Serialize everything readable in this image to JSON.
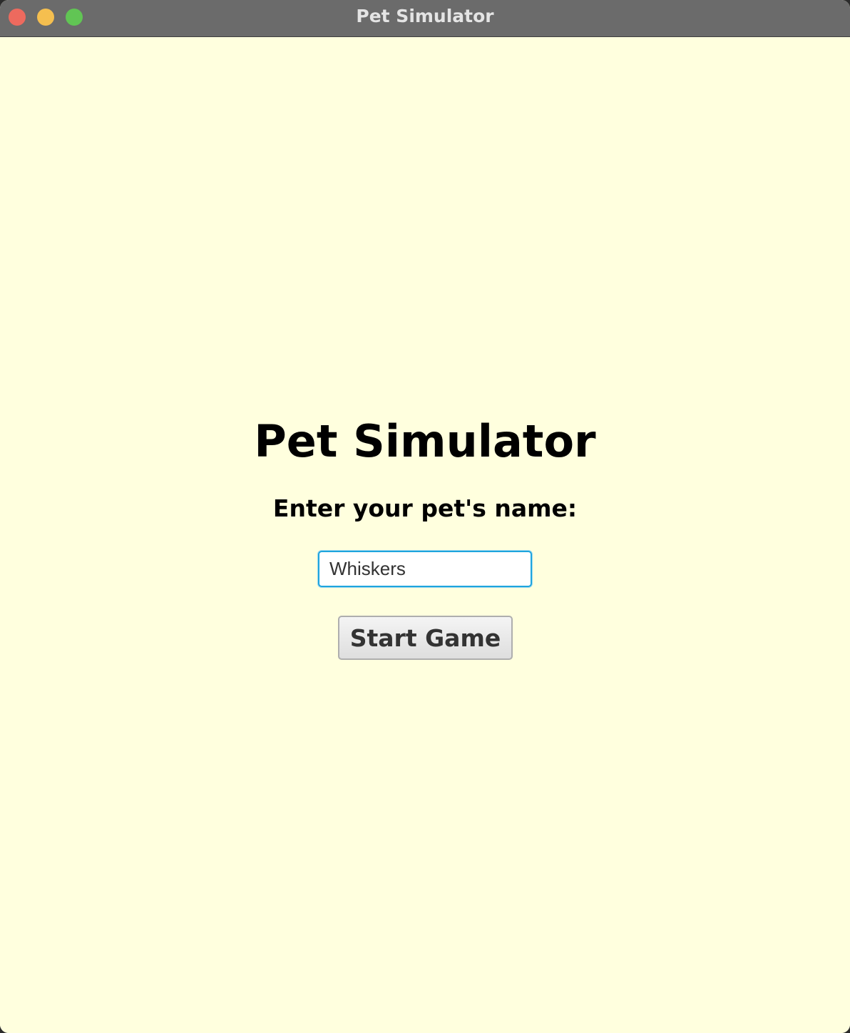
{
  "window": {
    "title": "Pet Simulator"
  },
  "main": {
    "title": "Pet Simulator",
    "prompt": "Enter your pet's name:",
    "name_input": {
      "value": "Whiskers",
      "focused": true
    },
    "start_button_label": "Start Game"
  },
  "colors": {
    "background": "#ffffde",
    "titlebar": "#6b6b6b",
    "focus_ring": "#1ea5dd",
    "close": "#ed6a5e",
    "minimize": "#f5bf4f",
    "zoom": "#61c554"
  },
  "icons": {
    "close": "close-icon",
    "minimize": "minimize-icon",
    "zoom": "zoom-icon"
  }
}
